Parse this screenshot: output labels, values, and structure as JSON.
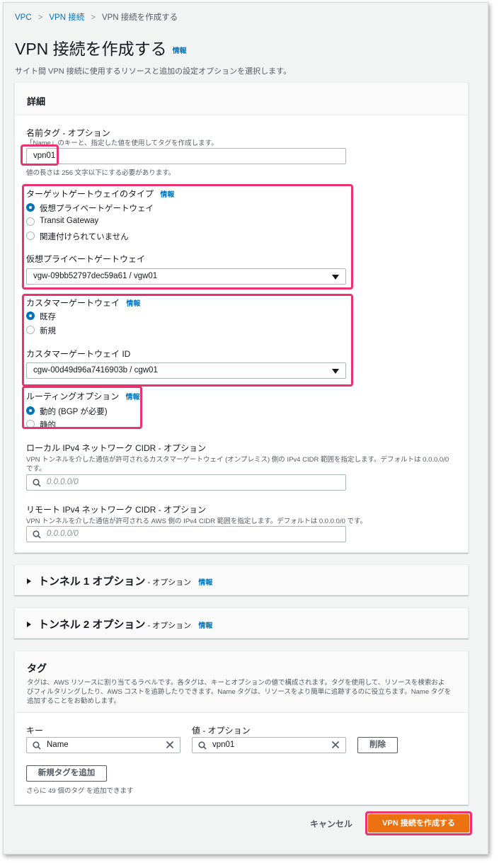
{
  "breadcrumb": [
    "VPC",
    "VPN 接続",
    "VPN 接続を作成する"
  ],
  "page": {
    "title": "VPN 接続を作成する",
    "info": "情報",
    "subtitle": "サイト間 VPN 接続に使用するリソースと追加の設定オプションを選択します。"
  },
  "details": {
    "header": "詳細",
    "name_tag": {
      "label": "名前タグ - オプション",
      "description": "「Name」のキーと、指定した値を使用してタグを作成します。",
      "value": "vpn01",
      "constraint": "値の長さは 256 文字以下にする必要があります。"
    },
    "target_gateway": {
      "label": "ターゲットゲートウェイのタイプ",
      "info": "情報",
      "options": [
        "仮想プライベートゲートウェイ",
        "Transit Gateway",
        "関連付けられていません"
      ],
      "selected": 0,
      "select_label": "仮想プライベートゲートウェイ",
      "select_value": "vgw-09bb52797dec59a61 / vgw01"
    },
    "customer_gateway": {
      "label": "カスタマーゲートウェイ",
      "info": "情報",
      "options": [
        "既存",
        "新規"
      ],
      "selected": 0,
      "select_label": "カスタマーゲートウェイ ID",
      "select_value": "cgw-00d49d96a7416903b / cgw01"
    },
    "routing": {
      "label": "ルーティングオプション",
      "info": "情報",
      "options": [
        "動的 (BGP が必要)",
        "静的"
      ],
      "selected": 0
    },
    "local_cidr": {
      "label": "ローカル IPv4 ネットワーク CIDR - オプション",
      "description_line1": "VPN トンネルを介した通信が許可されるカスタマーゲートウェイ (オンプレミス) 側の IPv4 CIDR 範囲を指定します。デフォルトは 0.0.0.0/0",
      "description_line2": "です。",
      "placeholder": "0.0.0.0/0"
    },
    "remote_cidr": {
      "label": "リモート IPv4 ネットワーク CIDR - オプション",
      "description": "VPN トンネルを介した通信が許可される AWS 側の IPv4 CIDR 範囲を指定します。デフォルトは 0.0.0.0/0 です。",
      "placeholder": "0.0.0.0/0"
    }
  },
  "tunnel1": {
    "title": "トンネル 1 オプション",
    "optional": " - オプション",
    "info": "情報"
  },
  "tunnel2": {
    "title": "トンネル 2 オプション",
    "optional": " - オプション",
    "info": "情報"
  },
  "tags": {
    "header": "タグ",
    "description_line1": "タグは、AWS リソースに割り当てるラベルです。各タグは、キーとオプションの値で構成されます。タグを使用して、リソースを検索およ",
    "description_line2": "びフィルタリングしたり、AWS コストを追跡したりできます。Name タグは、リソースをより簡単に追跡するのに役立ちます。Name タグを",
    "description_line3": "追加することをお勧めします。",
    "key_label": "キー",
    "value_label": "値 - オプション",
    "key_value": "Name",
    "value_value": "vpn01",
    "remove_button": "削除",
    "add_button": "新規タグを追加",
    "remaining": "さらに 49 個のタグ を追加できます"
  },
  "footer": {
    "cancel": "キャンセル",
    "create": "VPN 接続を作成する"
  },
  "colors": {
    "accent": "#0073bb",
    "primary": "#ec7211",
    "highlight": "#e8336f"
  },
  "icons": [
    "chevron-right-icon",
    "search-icon",
    "caret-down-icon",
    "clear-icon",
    "expand-triangle-icon"
  ]
}
